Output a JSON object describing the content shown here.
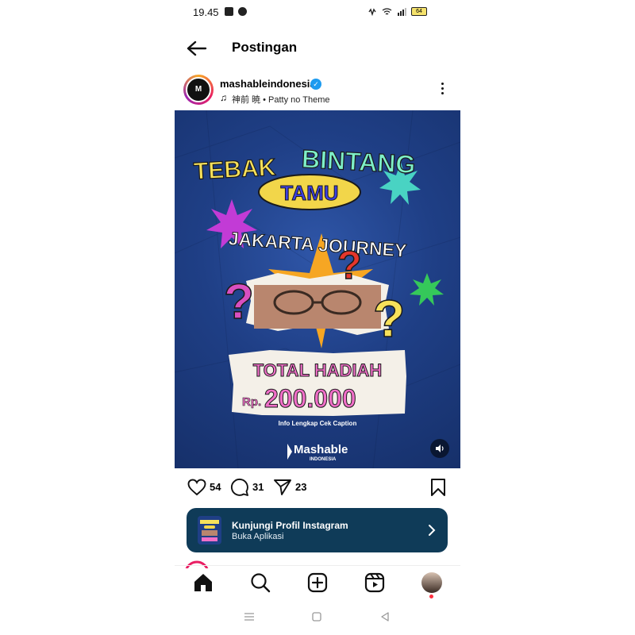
{
  "status_bar": {
    "time": "19.45",
    "battery": "64"
  },
  "header": {
    "title": "Postingan"
  },
  "post": {
    "username": "mashableindonesia",
    "avatar_text": "M",
    "music": "神前 暁 • Patty no Theme",
    "image": {
      "line1a": "TEBAK",
      "line1b": "BINTANG",
      "line2": "TAMU",
      "line3": "JAKARTA JOURNEY",
      "prize_label": "TOTAL HADIAH",
      "prize_currency": "Rp.",
      "prize_amount": "200.000",
      "caption_note": "Info Lengkap Cek Caption",
      "brand": "Mashable",
      "brand_sub": "INDONESIA"
    },
    "likes": "54",
    "comments": "31",
    "shares": "23"
  },
  "banner": {
    "title": "Kunjungi Profil Instagram",
    "subtitle": "Buka Aplikasi"
  },
  "icons": {
    "back": "arrow-left-icon",
    "more": "more-vertical-icon",
    "like": "heart-icon",
    "comment": "comment-icon",
    "share": "send-icon",
    "save": "bookmark-icon",
    "home": "home-icon",
    "search": "search-icon",
    "create": "plus-square-icon",
    "reels": "reels-icon",
    "volume": "speaker-icon"
  },
  "colors": {
    "poster_blue": "#1f3f86",
    "banner_bg": "#0f3b58",
    "verified": "#1d9bf0",
    "notification_dot": "#ff3040",
    "title_yellow": "#f7e15a",
    "title_mint": "#7ef0c8",
    "prize_pink": "#f06fc8"
  }
}
